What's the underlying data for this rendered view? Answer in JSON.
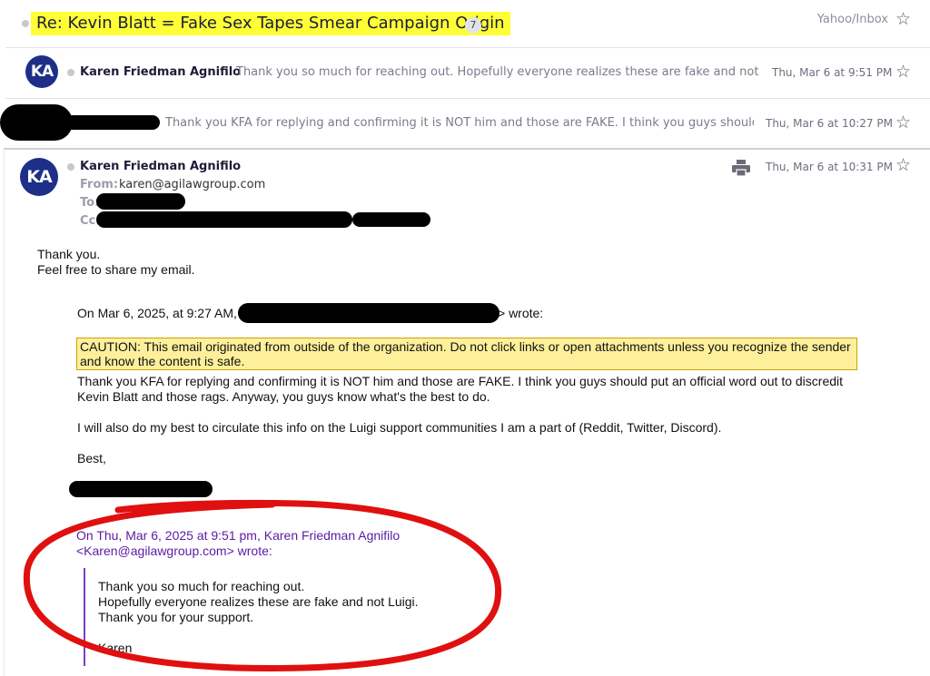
{
  "thread": {
    "subject": "Re: Kevin Blatt = Fake Sex Tapes Smear Campaign Origin",
    "count": "7",
    "folder": "Yahoo/Inbox"
  },
  "messages": [
    {
      "avatar": "KA",
      "sender": "Karen Friedman Agnifilo",
      "snippet": "Thank you so much for reaching out. Hopefully everyone realizes these are fake and not Luigi",
      "date": "Thu, Mar 6 at 9:51 PM"
    },
    {
      "snippet": "Thank you KFA for replying and confirming it is NOT him and those are FAKE. I think you guys should put",
      "date": "Thu, Mar 6 at 10:27 PM"
    }
  ],
  "open_message": {
    "avatar": "KA",
    "sender": "Karen Friedman Agnifilo",
    "date": "Thu, Mar 6 at 10:31 PM",
    "from_label": "From:",
    "from_value": "karen@agilawgroup.com",
    "to_label": "To:",
    "cc_label": "Cc:",
    "body_line1": "Thank you.",
    "body_line2": "Feel free to share my email.",
    "quote_intro_prefix": "On Mar 6, 2025, at 9:27 AM,",
    "quote_intro_suffix": "> wrote:",
    "caution_line1": "CAUTION: This email originated from outside of the organization. Do not click links or open attachments unless you recognize the sender",
    "caution_line2": "and know the content is safe.",
    "reply_line1": "Thank you KFA for replying and confirming it is NOT him and those are FAKE. I think you guys should put an official word out to discredit",
    "reply_line2": "Kevin Blatt and those rags. Anyway, you guys know what's the best to do.",
    "reply_line3": "I will also do my best to circulate this info on the Luigi support communities I am a part of (Reddit, Twitter, Discord).",
    "reply_signoff": "Best,",
    "nested_head1": "On Thu, Mar 6, 2025 at 9:51 pm, Karen Friedman Agnifilo",
    "nested_head2": "<Karen@agilawgroup.com> wrote:",
    "nested_line1": "Thank you so much for reaching out.",
    "nested_line2": "Hopefully everyone realizes these are fake and not Luigi.",
    "nested_line3": "Thank you for your support.",
    "nested_sign": "Karen"
  },
  "icons": {
    "star": "☆",
    "print": "printer-icon"
  },
  "colors": {
    "highlight": "#ffff35",
    "avatar_bg": "#1d2f88",
    "annotation_circle": "#e01010",
    "quote_purple": "#5b1aa6"
  }
}
